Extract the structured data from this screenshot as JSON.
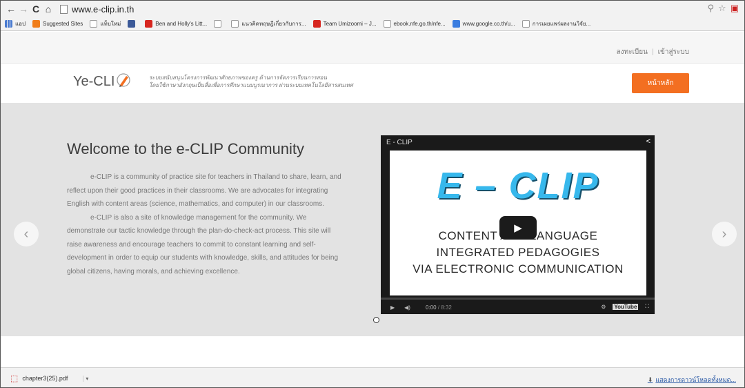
{
  "browser": {
    "url": "www.e-clip.in.th",
    "bookmarks": [
      {
        "label": "แอป",
        "icon": "apps-grid-icon"
      },
      {
        "label": "Suggested Sites",
        "icon": "suggested-sites-icon"
      },
      {
        "label": "แท็บใหม่",
        "icon": "page-icon"
      },
      {
        "label": "",
        "icon": "facebook-icon"
      },
      {
        "label": "Ben and Holly's Litt...",
        "icon": "youtube-icon"
      },
      {
        "label": "",
        "icon": "page-icon"
      },
      {
        "label": "แนวคิดทฤษฎีเกี่ยวกับการ...",
        "icon": "page-icon"
      },
      {
        "label": "Team Umizoomi – J...",
        "icon": "youtube-icon"
      },
      {
        "label": "ebook.nfe.go.th/nfe...",
        "icon": "page-icon"
      },
      {
        "label": "www.google.co.th/u...",
        "icon": "google-icon"
      },
      {
        "label": "การเผยแพร่ผลงานวิจัย...",
        "icon": "page-icon"
      }
    ]
  },
  "site": {
    "top_links": {
      "register": "ลงทะเบียน",
      "login": "เข้าสู่ระบบ"
    },
    "logo_text": "Ye-CLI",
    "tagline_line1": "ระบบสนับสนุนโครงการพัฒนาศักยภาพของครู ด้านการจัดการเรียนการสอน",
    "tagline_line2": "โดยใช้ภาษาอังกฤษเป็นสื่อเพื่อการศึกษาแบบบูรณาการ ผ่านระบบเทคโนโลยีสารสนเทศ",
    "home_button": "หน้าหลัก",
    "accent": "#f36f21"
  },
  "hero": {
    "title": "Welcome to the e-CLIP Community",
    "paragraph1": "e-CLIP is a community of practice site for teachers in Thailand to share, learn, and reflect upon their good practices in their classrooms. We are advocates for integrating English with content areas (science, mathematics, and computer) in our classrooms.",
    "paragraph2": "e-CLIP is also a site of knowledge management for the community. We demonstrate our tactic knowledge through the plan-do-check-act process. This site will raise awareness and encourage teachers to commit to constant learning and self-development in order to equip our students with knowledge, skills, and attitudes for being global citizens, having morals, and achieving excellence."
  },
  "video": {
    "title": "E - CLIP",
    "big_title": "E – CLIP",
    "line1": "CONTENT AND LANGUAGE",
    "line2": "INTEGRATED PEDAGOGIES",
    "line3": "VIA ELECTRONIC COMMUNICATION",
    "time_current": "0:00",
    "time_total": "8:32",
    "youtube_label": "YouTube"
  },
  "downloads": {
    "file": "chapter3(25).pdf",
    "show_all": "แสดงการดาวน์โหลดทั้งหมด..."
  }
}
